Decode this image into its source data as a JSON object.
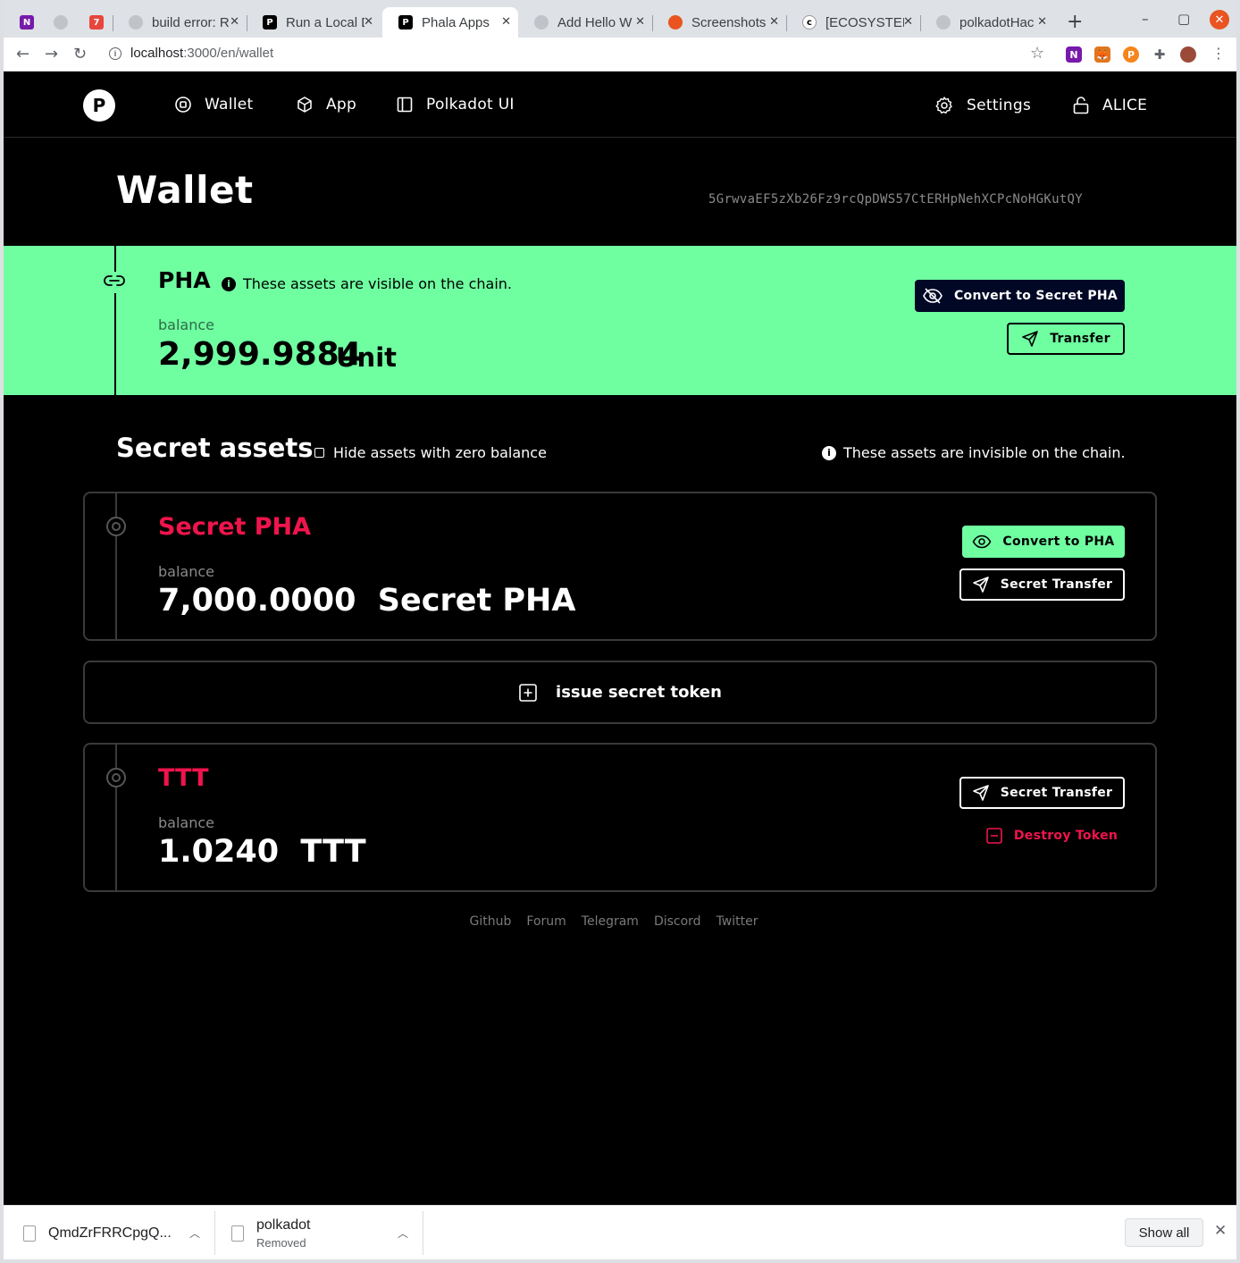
{
  "browser": {
    "tabs": [
      {
        "title": "",
        "icon": "onenote-icon",
        "color": "#7719aa"
      },
      {
        "title": "",
        "icon": "github-icon",
        "color": "#c0c4c9"
      },
      {
        "title": "",
        "icon": "calendar-icon",
        "color": "#e8453c"
      },
      {
        "title": "build error: R",
        "icon": "github-icon",
        "color": "#c0c4c9"
      },
      {
        "title": "Run a Local D",
        "icon": "phala-icon",
        "color": "#000000"
      },
      {
        "title": "Phala Apps",
        "icon": "phala-icon",
        "color": "#000000",
        "active": true
      },
      {
        "title": "Add Hello W",
        "icon": "github-icon",
        "color": "#c0c4c9"
      },
      {
        "title": "Screenshots",
        "icon": "ubuntu-icon",
        "color": "#e95420"
      },
      {
        "title": "[ECOSYSTEM",
        "icon": "forum-icon",
        "color": "#ffffff"
      },
      {
        "title": "polkadotHac",
        "icon": "github-icon",
        "color": "#c0c4c9"
      }
    ],
    "url_host": "localhost",
    "url_path": ":3000/en/wallet"
  },
  "header": {
    "logo_text": "P",
    "nav": [
      {
        "label": "Wallet",
        "icon": "wallet-icon"
      },
      {
        "label": "App",
        "icon": "cube-icon"
      },
      {
        "label": "Polkadot UI",
        "icon": "sidebar-icon"
      }
    ],
    "settings_label": "Settings",
    "account_label": "ALICE"
  },
  "wallet": {
    "title": "Wallet",
    "address": "5GrwvaEF5zXb26Fz9rcQpDWS57CtERHpNehXCPcNoHGKutQY"
  },
  "public_asset": {
    "symbol": "PHA",
    "note": "These assets are visible on the chain.",
    "balance_label": "balance",
    "balance_value": "2,999.9884",
    "balance_unit": "Unit",
    "convert_label": "Convert to Secret PHA",
    "transfer_label": "Transfer",
    "accent": "#6fffa1"
  },
  "secret": {
    "heading": "Secret assets",
    "hide_zero_label": "Hide assets with zero balance",
    "note": "These assets are invisible on the chain.",
    "assets": [
      {
        "name": "Secret PHA",
        "balance_label": "balance",
        "balance_text": "7,000.0000  Secret PHA",
        "convert_label": "Convert to PHA",
        "transfer_label": "Secret Transfer"
      },
      {
        "name": "TTT",
        "balance_label": "balance",
        "balance_text": "1.0240  TTT",
        "transfer_label": "Secret Transfer",
        "destroy_label": "Destroy Token"
      }
    ],
    "issue_label": "issue secret token",
    "accent": "#f0144c"
  },
  "footer": {
    "links": [
      "Github",
      "Forum",
      "Telegram",
      "Discord",
      "Twitter"
    ]
  },
  "downloads": {
    "items": [
      {
        "name": "QmdZrFRRCpgQ...",
        "status": ""
      },
      {
        "name": "polkadot",
        "status": "Removed"
      }
    ],
    "show_all_label": "Show all"
  }
}
